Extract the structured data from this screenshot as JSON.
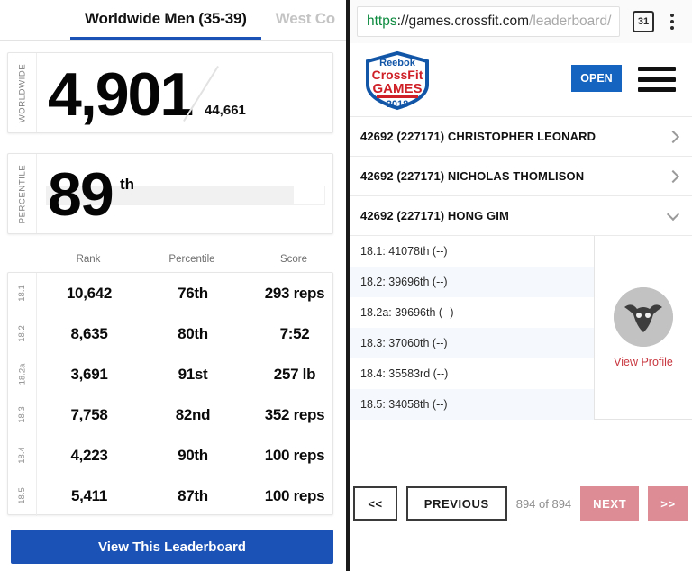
{
  "left": {
    "tabs": [
      {
        "label": "Worldwide Men (35-39)",
        "active": true
      },
      {
        "label": "West Co",
        "active": false
      }
    ],
    "worldwide_card": {
      "side_label": "WORLDWIDE",
      "rank": "4,901",
      "total": "44,661"
    },
    "percentile_card": {
      "side_label": "PERCENTILE",
      "value": "89",
      "suffix": "th",
      "fill_percent": 89
    },
    "table": {
      "headers": {
        "rank": "Rank",
        "percentile": "Percentile",
        "score": "Score"
      },
      "rows": [
        {
          "workout": "18.1",
          "rank": "10,642",
          "percentile": "76th",
          "score": "293 reps"
        },
        {
          "workout": "18.2",
          "rank": "8,635",
          "percentile": "80th",
          "score": "7:52"
        },
        {
          "workout": "18.2a",
          "rank": "3,691",
          "percentile": "91st",
          "score": "257 lb"
        },
        {
          "workout": "18.3",
          "rank": "7,758",
          "percentile": "82nd",
          "score": "352 reps"
        },
        {
          "workout": "18.4",
          "rank": "4,223",
          "percentile": "90th",
          "score": "100 reps"
        },
        {
          "workout": "18.5",
          "rank": "5,411",
          "percentile": "87th",
          "score": "100 reps"
        }
      ]
    },
    "view_leaderboard_label": "View This Leaderboard",
    "accent_blue": "#1b52b5"
  },
  "right": {
    "browser": {
      "url_scheme": "https",
      "url_host": "://games.crossfit.com",
      "url_path": "/leaderboard/",
      "calendar_day": "31"
    },
    "site_header": {
      "logo_line1": "Reebok",
      "logo_line2": "CrossFit",
      "logo_line3": "GAMES",
      "logo_year": "2018",
      "open_label": "OPEN"
    },
    "athletes": [
      {
        "score": "42692",
        "id": "(227171)",
        "name": "CHRISTOPHER LEONARD",
        "expanded": false
      },
      {
        "score": "42692",
        "id": "(227171)",
        "name": "NICHOLAS THOMLISON",
        "expanded": false
      },
      {
        "score": "42692",
        "id": "(227171)",
        "name": "HONG GIM",
        "expanded": true
      }
    ],
    "detail": {
      "items": [
        "18.1: 41078th (--)",
        "18.2: 39696th (--)",
        "18.2a: 39696th (--)",
        "18.3: 37060th (--)",
        "18.4: 35583rd (--)",
        "18.5: 34058th (--)"
      ],
      "view_profile_label": "View Profile",
      "view_profile_color": "#c8373f"
    },
    "pager": {
      "first_label": "<<",
      "previous_label": "PREVIOUS",
      "count_label": "894 of 894",
      "next_label": "NEXT",
      "last_label": ">>",
      "disabled_color": "#dd8c96"
    }
  }
}
